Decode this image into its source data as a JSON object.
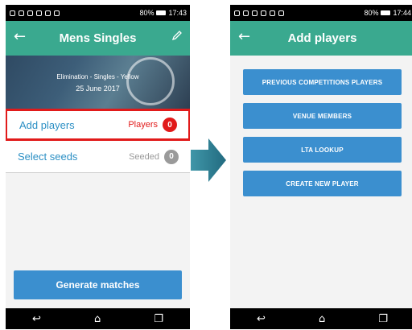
{
  "left": {
    "status": {
      "battery": "80%",
      "time": "17:43"
    },
    "appbar": {
      "title": "Mens Singles",
      "back_glyph": "←"
    },
    "hero": {
      "line1": "Elimination - Singles - Yellow",
      "line2": "25 June 2017"
    },
    "rows": [
      {
        "label": "Add players",
        "meta": "Players",
        "count": "0"
      },
      {
        "label": "Select seeds",
        "meta": "Seeded",
        "count": "0"
      }
    ],
    "generate_label": "Generate matches"
  },
  "right": {
    "status": {
      "battery": "80%",
      "time": "17:44"
    },
    "appbar": {
      "title": "Add players",
      "back_glyph": "←"
    },
    "buttons": [
      "PREVIOUS COMPETITIONS PLAYERS",
      "VENUE MEMBERS",
      "LTA LOOKUP",
      "CREATE NEW PLAYER"
    ]
  },
  "nav": {
    "back": "↩",
    "home": "⌂",
    "recents": "❐"
  },
  "colors": {
    "teal": "#3aa98f",
    "blue": "#3b8fcf",
    "red": "#e11a1a",
    "grey": "#9a9a9a",
    "arrow": "#2e7f95"
  },
  "icons": [
    "back-arrow-icon",
    "edit-pencil-icon",
    "battery-icon",
    "transition-arrow-icon",
    "nav-back-icon",
    "nav-home-icon",
    "nav-recents-icon"
  ]
}
